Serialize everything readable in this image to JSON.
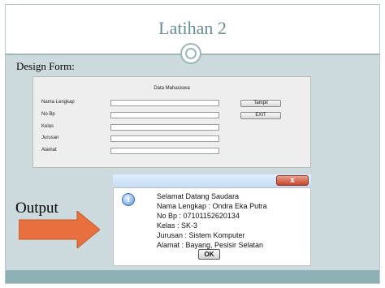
{
  "slide": {
    "title": "Latihan 2",
    "design_label": "Design Form:",
    "output_label": "Output"
  },
  "form": {
    "title": "Data Mahasiswa",
    "fields": [
      {
        "label": "Nama Lengkap",
        "value": ""
      },
      {
        "label": "No Bp",
        "value": ""
      },
      {
        "label": "Kelas",
        "value": ""
      },
      {
        "label": "Jurusan",
        "value": ""
      },
      {
        "label": "Alamat",
        "value": ""
      }
    ],
    "buttons": {
      "tampil": "Tampil",
      "exit": "EXIT"
    }
  },
  "dialog": {
    "close_symbol": "x",
    "icon_glyph": "i",
    "lines": [
      "Selamat Datang Saudara",
      "Nama Lengkap : Ondra Eka Putra",
      "No Bp : 07101152620134",
      "Kelas : SK-3",
      "Jurusan : Sistem Komputer",
      "Alamat : Bayang, Pesisir Selatan"
    ],
    "ok_label": "OK"
  },
  "colors": {
    "title": "#6a8e94",
    "content_background": "#ccdadd",
    "arrow_fill": "#e8703f",
    "close_button": "#c6452b"
  }
}
